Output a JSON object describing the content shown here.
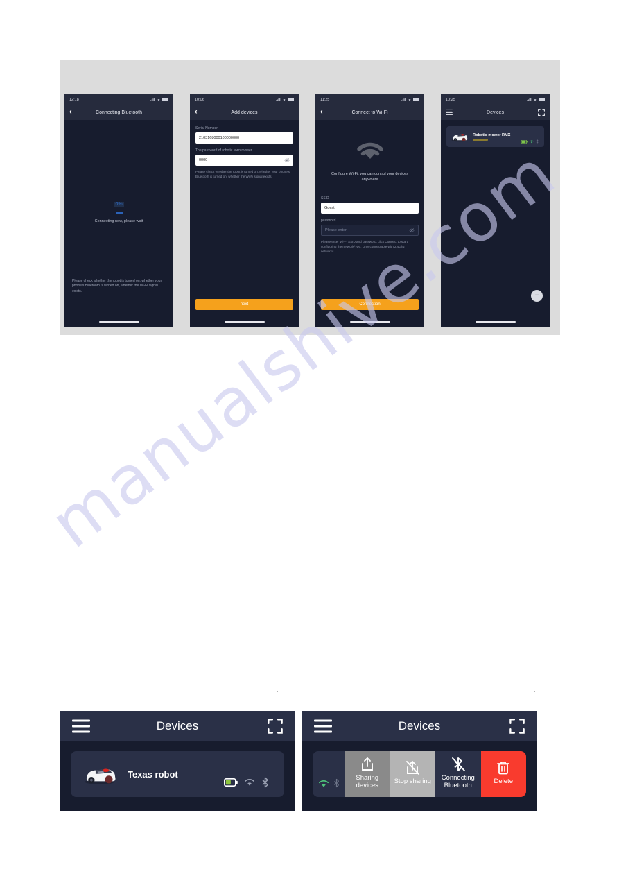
{
  "watermark": {
    "text": "manualshive.com"
  },
  "phones": [
    {
      "id": "connecting-bluetooth",
      "status_time": "12:18",
      "nav_title": "Connecting Bluetooth",
      "back_icon": "chevron-left-icon",
      "progress_percent": "0%",
      "waiting_text": "Connecting now, please wait",
      "note": "Please check whether the robot is turned on, whether your phone's Bluetooth is turned on, whether the Wi-Fi signal exists."
    },
    {
      "id": "add-devices",
      "status_time": "10:06",
      "nav_title": "Add devices",
      "serial_label": "Serial Number",
      "serial_value": "2103168000100000000",
      "password_label": "The password of robotic lawn mower",
      "password_value": "0000",
      "eye_icon": "eye-off-icon",
      "note": "Please check whether the robot is turned on, whether your phone's Bluetooth is turned on, whether the Wi-Fi signal exists.",
      "cta_label": "next"
    },
    {
      "id": "connect-to-wifi",
      "status_time": "11:25",
      "nav_title": "Connect to Wi-Fi",
      "hero_icon": "wifi-icon",
      "hero_text": "Configure Wi-Fi, you can control your devices anywhere",
      "ssid_label": "SSID",
      "ssid_value": "Guest",
      "password_label": "password",
      "password_placeholder": "Please enter",
      "eye_icon": "eye-off-icon",
      "note": "Please enter Wi-Fi SSID and password, click Connect to start configuring the network/Two. Only connectable with 2.4Ghz networks.",
      "cta_label": "Connection"
    },
    {
      "id": "devices-list",
      "status_time": "10:25",
      "nav_title": "Devices",
      "menu_icon": "hamburger-icon",
      "expand_icon": "fullscreen-icon",
      "device_name": "Robotic mower RMX",
      "device_icons": [
        "battery-icon",
        "wifi-icon",
        "bluetooth-icon"
      ],
      "fab_label": "+"
    }
  ],
  "panels": {
    "left": {
      "title": "Devices",
      "menu_icon": "hamburger-icon",
      "expand_icon": "fullscreen-icon",
      "device_name": "Texas robot",
      "device_icons": [
        "battery-icon",
        "wifi-icon",
        "bluetooth-icon"
      ]
    },
    "right": {
      "title": "Devices",
      "menu_icon": "hamburger-icon",
      "expand_icon": "fullscreen-icon",
      "row_icons": [
        "wifi-icon",
        "bluetooth-icon"
      ],
      "actions": [
        {
          "label": "Sharing devices",
          "icon": "share-up-icon",
          "color": "#8a8a8a"
        },
        {
          "label": "Stop sharing",
          "icon": "share-up-slash-icon",
          "color": "#b4b4b4"
        },
        {
          "label": "Connecting Bluetooth",
          "icon": "bluetooth-slash-icon",
          "color": "#2a3047"
        },
        {
          "label": "Delete",
          "icon": "trash-icon",
          "color": "#f93b2e"
        }
      ]
    }
  },
  "colors": {
    "accent_orange": "#f5a11c",
    "danger_red": "#f93b2e",
    "panel_dark": "#171c2e",
    "header_dark": "#2a3047",
    "battery_green": "#7ec34a"
  }
}
